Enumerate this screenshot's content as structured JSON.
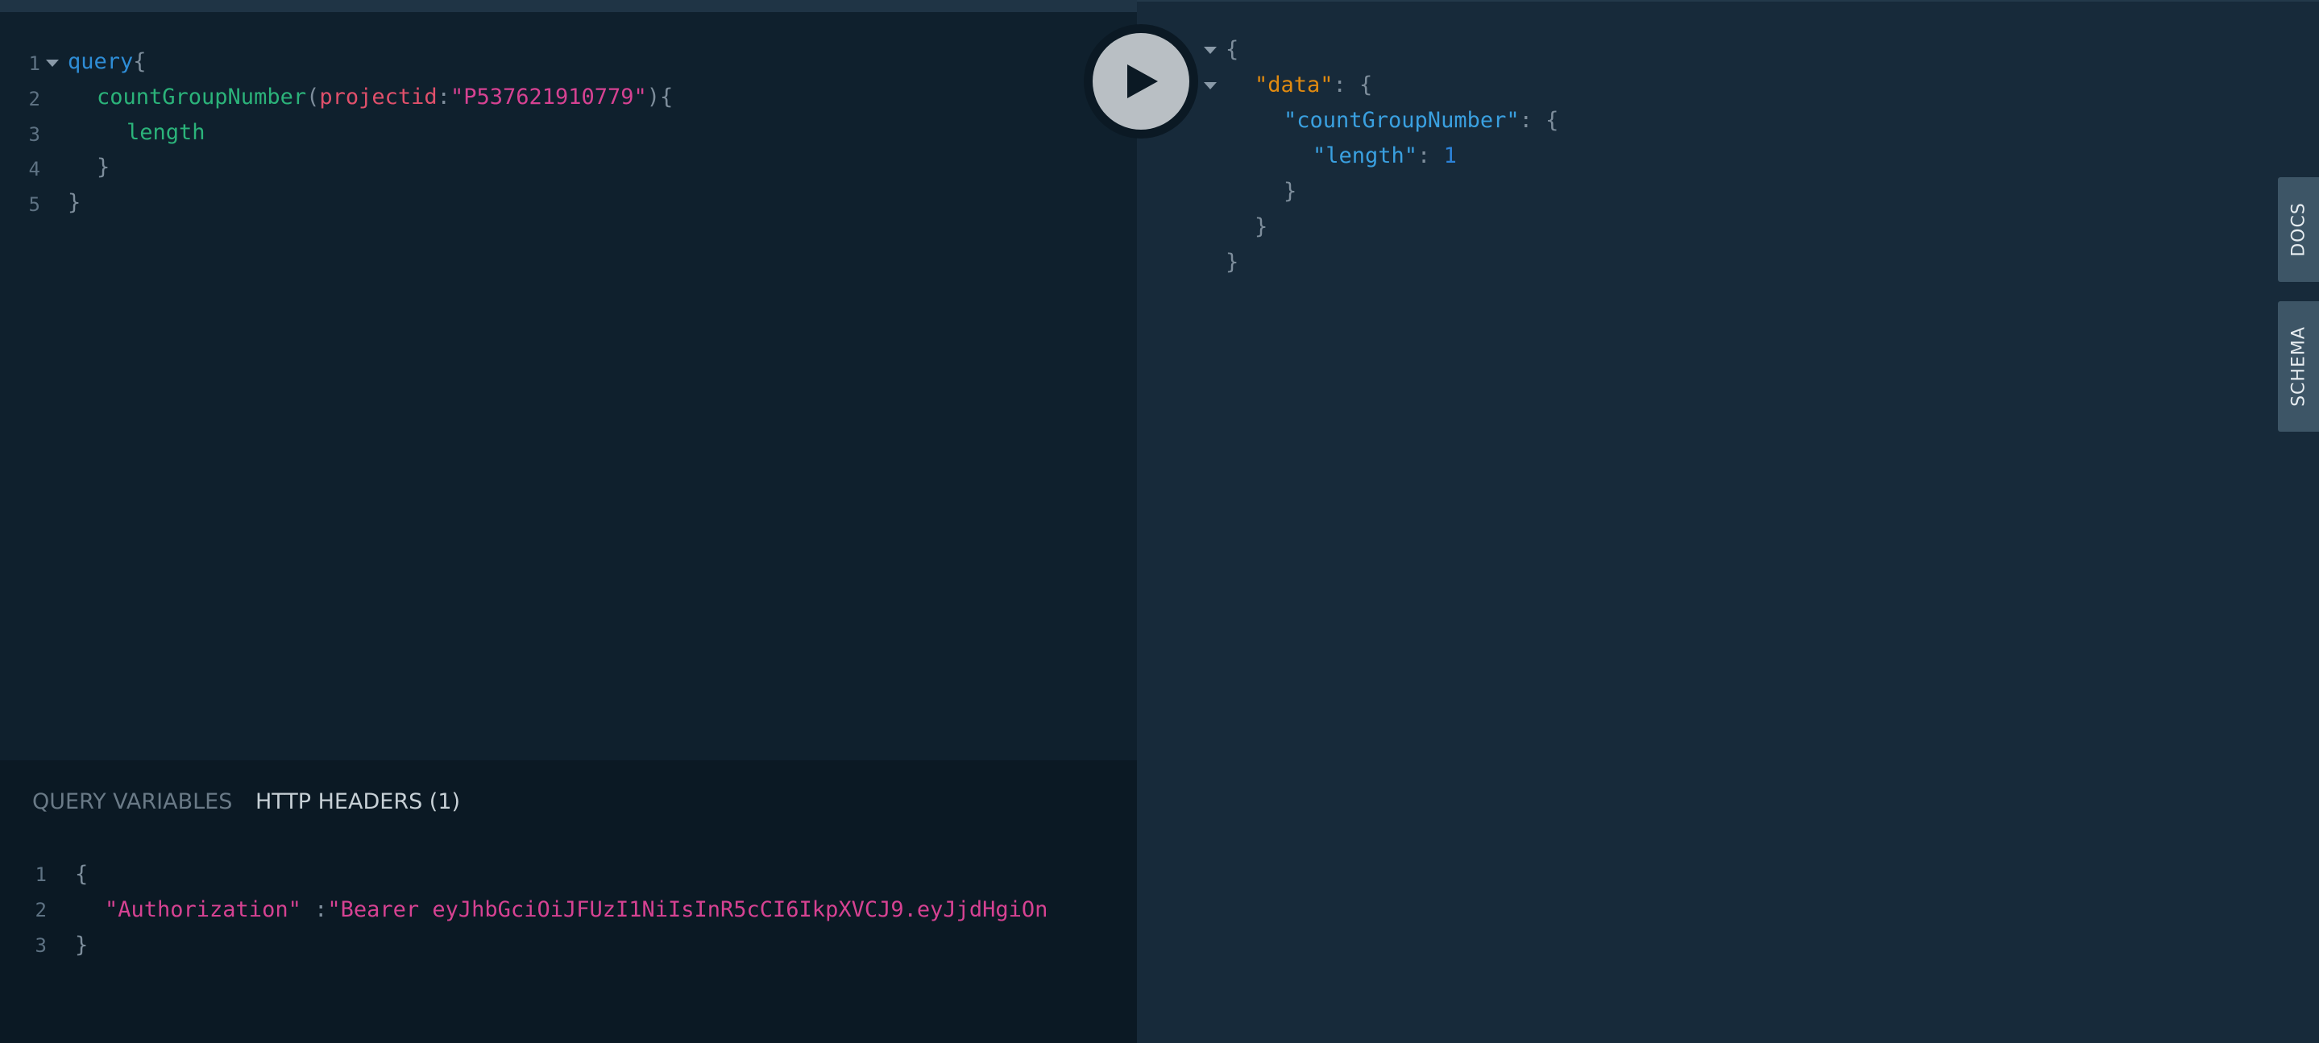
{
  "query_editor": {
    "line_numbers": [
      "1",
      "2",
      "3",
      "4",
      "5"
    ],
    "keyword": "query",
    "open_brace": "{",
    "field_name": "countGroupNumber",
    "paren_open": "(",
    "arg_name": "projectid",
    "colon": ":",
    "arg_value": "\"P537621910779\"",
    "paren_close_brace": "){",
    "subfield": "length",
    "close_brace": "}"
  },
  "run_button": {
    "icon": "play-icon"
  },
  "result": {
    "open_brace": "{",
    "data_key": "\"data\"",
    "colon_brace": ": {",
    "count_key": "\"countGroupNumber\"",
    "length_key": "\"length\"",
    "colon": ": ",
    "length_value": "1",
    "close_brace": "}"
  },
  "vars_pane": {
    "tabs": [
      {
        "label": "QUERY VARIABLES",
        "active": false
      },
      {
        "label": "HTTP HEADERS (1)",
        "active": true
      }
    ],
    "line_numbers": [
      "1",
      "2",
      "3"
    ],
    "open_brace": "{",
    "header_key": "\"Authorization\"",
    "header_sep": " :",
    "header_value": "\"Bearer eyJhbGciOiJFUzI1NiIsInR5cCI6IkpXVCJ9.eyJjdHgiOn",
    "close_brace": "}"
  },
  "side_tabs": {
    "docs": "DOCS",
    "schema": "SCHEMA"
  },
  "colors": {
    "editor_bg": "#0f202d",
    "result_bg": "#172a3a",
    "vars_bg": "#0b1924",
    "keyword": "#2e8dd6",
    "field": "#2bb37a",
    "argument": "#e0506b",
    "string": "#d64292",
    "data_key": "#e08a10"
  }
}
